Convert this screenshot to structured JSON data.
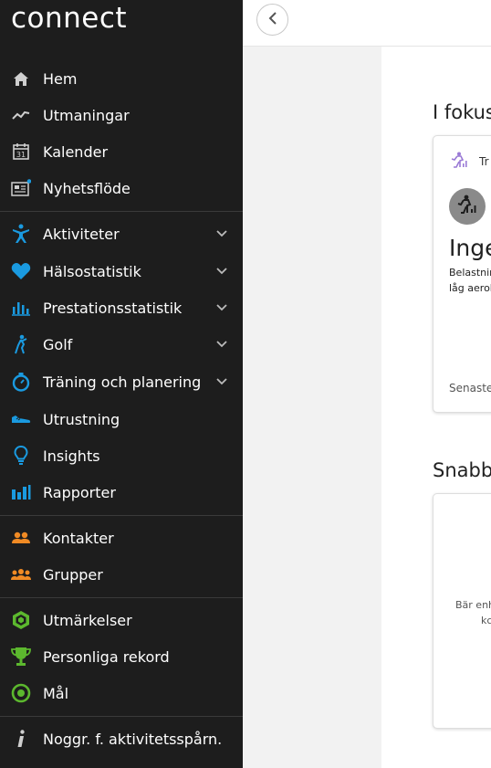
{
  "app": {
    "logo": "connect"
  },
  "sidebar": {
    "items": [
      {
        "label": "Hem",
        "icon": "home-icon",
        "color": "#cfcfcf",
        "expandable": false
      },
      {
        "label": "Utmaningar",
        "icon": "challenges-icon",
        "color": "#cfcfcf",
        "expandable": false
      },
      {
        "label": "Kalender",
        "icon": "calendar-icon",
        "color": "#cfcfcf",
        "expandable": false
      },
      {
        "label": "Nyhetsflöde",
        "icon": "newsfeed-icon",
        "color": "#cfcfcf",
        "expandable": false
      },
      {
        "label": "Aktiviteter",
        "icon": "activities-icon",
        "color": "#1a9ae0",
        "expandable": true
      },
      {
        "label": "Hälsostatistik",
        "icon": "heart-icon",
        "color": "#1a9ae0",
        "expandable": true
      },
      {
        "label": "Prestationsstatistik",
        "icon": "performance-stats-icon",
        "color": "#1a9ae0",
        "expandable": true
      },
      {
        "label": "Golf",
        "icon": "golf-icon",
        "color": "#1a9ae0",
        "expandable": true
      },
      {
        "label": "Träning och planering",
        "icon": "stopwatch-icon",
        "color": "#1a9ae0",
        "expandable": true
      },
      {
        "label": "Utrustning",
        "icon": "shoe-icon",
        "color": "#1a9ae0",
        "expandable": false
      },
      {
        "label": "Insights",
        "icon": "lightbulb-icon",
        "color": "#1a9ae0",
        "expandable": false
      },
      {
        "label": "Rapporter",
        "icon": "reports-icon",
        "color": "#1a9ae0",
        "expandable": false
      },
      {
        "label": "Kontakter",
        "icon": "contacts-icon",
        "color": "#f08a24",
        "expandable": false
      },
      {
        "label": "Grupper",
        "icon": "groups-icon",
        "color": "#f08a24",
        "expandable": false
      },
      {
        "label": "Utmärkelser",
        "icon": "badge-icon",
        "color": "#5cb82e",
        "expandable": false
      },
      {
        "label": "Personliga rekord",
        "icon": "trophy-icon",
        "color": "#5cb82e",
        "expandable": false
      },
      {
        "label": "Mål",
        "icon": "target-icon",
        "color": "#5cb82e",
        "expandable": false
      },
      {
        "label": "Noggr. f. aktivitetsspårn.",
        "icon": "info-icon",
        "color": "#cfcfcf",
        "expandable": false
      }
    ]
  },
  "main": {
    "focus_title": "I fokus",
    "focus_card": {
      "small_label": "Tr",
      "big_text": "Inge",
      "desc_line1": "Belastnir",
      "desc_line2": "låg aerol",
      "latest": "Senaste"
    },
    "quick_title": "Snabb",
    "quick_card": {
      "line1": "Bär enh",
      "line2": "kc"
    }
  }
}
